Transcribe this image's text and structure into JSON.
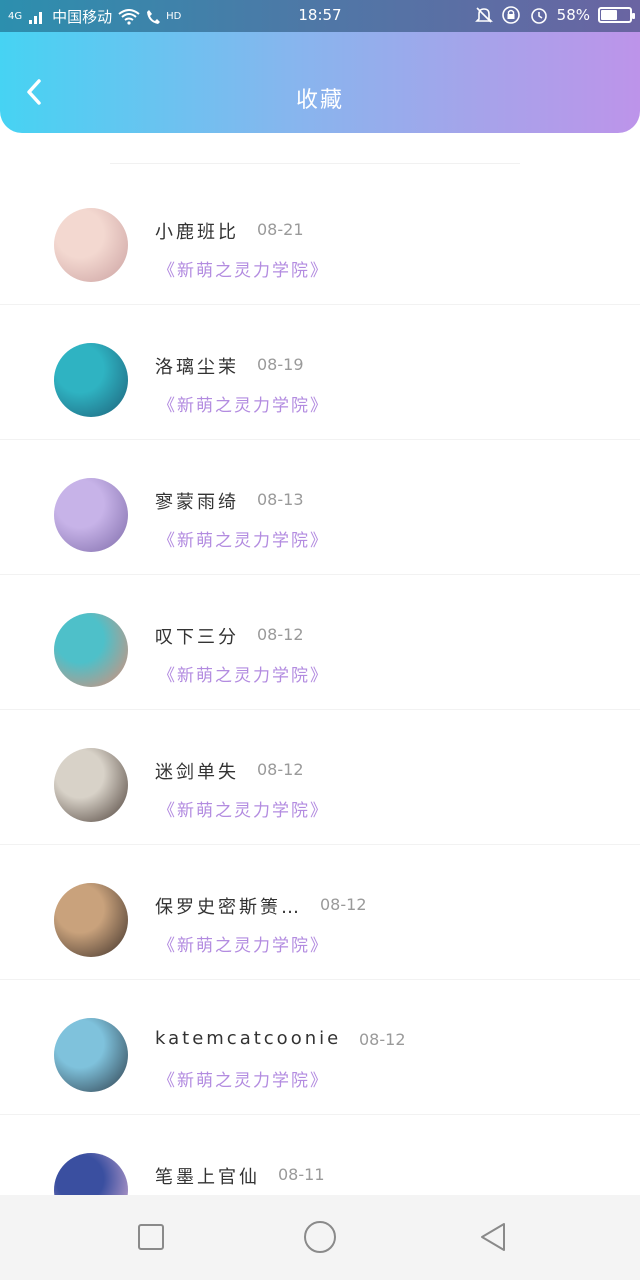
{
  "status_bar": {
    "network": "4G",
    "carrier": "中国移动",
    "hd": "HD",
    "time": "18:57",
    "battery": "58%",
    "battery_level": 0.58
  },
  "header": {
    "title": "收藏"
  },
  "items": [
    {
      "name": "小鹿班比",
      "date": "08-21",
      "book": "《新萌之灵力学院》",
      "avatar_colors": [
        "#f3d8d0",
        "#caa0a0"
      ]
    },
    {
      "name": "洛璃尘茉",
      "date": "08-19",
      "book": "《新萌之灵力学院》",
      "avatar_colors": [
        "#2fb3c2",
        "#1d5e77"
      ]
    },
    {
      "name": "寥蒙雨绮",
      "date": "08-13",
      "book": "《新萌之灵力学院》",
      "avatar_colors": [
        "#c7b3e8",
        "#7d6aa8"
      ]
    },
    {
      "name": "叹下三分",
      "date": "08-12",
      "book": "《新萌之灵力学院》",
      "avatar_colors": [
        "#4ec0c9",
        "#e28a72"
      ]
    },
    {
      "name": "迷剑单失",
      "date": "08-12",
      "book": "《新萌之灵力学院》",
      "avatar_colors": [
        "#d8d2c8",
        "#4a3d36"
      ]
    },
    {
      "name": "保罗史密斯箦…",
      "date": "08-12",
      "book": "《新萌之灵力学院》",
      "avatar_colors": [
        "#c9a27c",
        "#3b2e27"
      ]
    },
    {
      "name": "katemcatcoonie",
      "date": "08-12",
      "book": "《新萌之灵力学院》",
      "avatar_colors": [
        "#7fc2dc",
        "#2c3b48"
      ]
    },
    {
      "name": "笔墨上官仙",
      "date": "08-11",
      "book": "",
      "avatar_colors": [
        "#3a4fa0",
        "#e3b6d8"
      ]
    }
  ]
}
